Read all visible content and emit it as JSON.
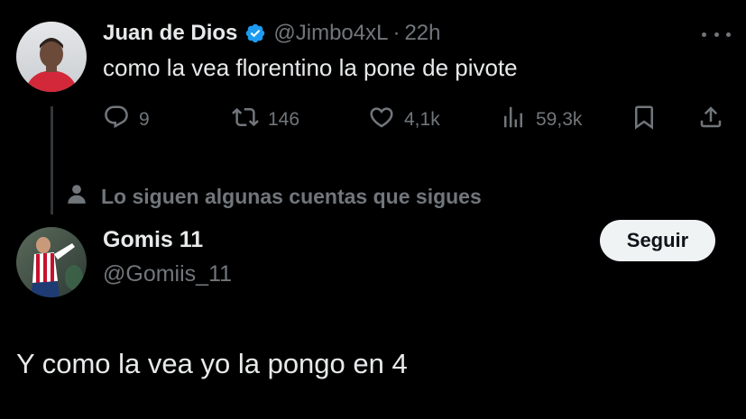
{
  "tweet": {
    "display_name": "Juan de Dios",
    "handle": "@Jimbo4xL",
    "separator": "·",
    "time": "22h",
    "text": "como la vea florentino la pone de pivote",
    "actions": {
      "replies": "9",
      "reposts": "146",
      "likes": "4,1k",
      "views": "59,3k"
    }
  },
  "social_context": "Lo siguen algunas cuentas que sigues",
  "reply_user": {
    "display_name": "Gomis 11",
    "handle": "@Gomiis_11",
    "follow_label": "Seguir"
  },
  "reply": {
    "text": "Y como la vea yo la pongo en 4"
  },
  "colors": {
    "background": "#000000",
    "text_primary": "#e7e9ea",
    "text_secondary": "#71767b",
    "verified_blue": "#1d9bf0",
    "follow_bg": "#eff3f4"
  },
  "icons": [
    "verified-badge-icon",
    "more-icon",
    "reply-icon",
    "repost-icon",
    "like-icon",
    "views-icon",
    "bookmark-icon",
    "share-icon",
    "person-icon"
  ]
}
